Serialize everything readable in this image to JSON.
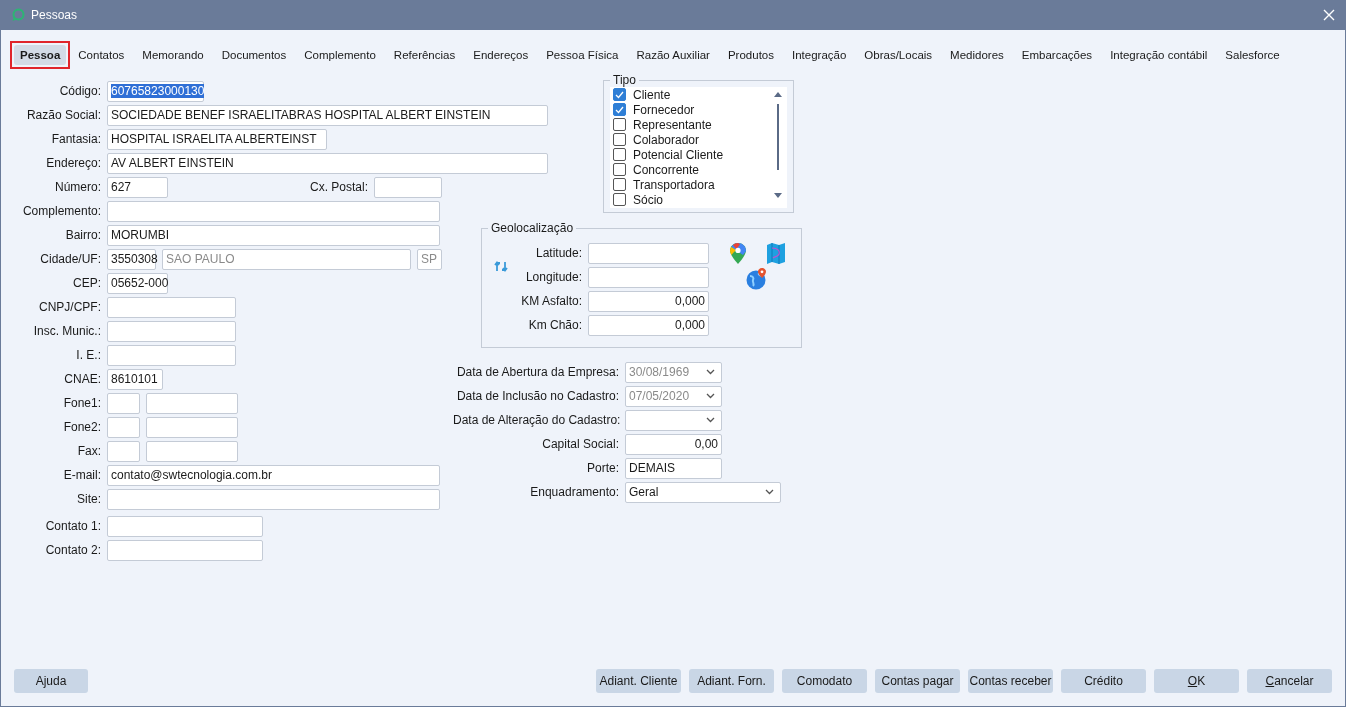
{
  "window": {
    "title": "Pessoas"
  },
  "tabs": [
    {
      "label": "Pessoa",
      "selected": true,
      "annotated": true
    },
    {
      "label": "Contatos",
      "selected": false,
      "annotated": false
    },
    {
      "label": "Memorando",
      "selected": false,
      "annotated": false
    },
    {
      "label": "Documentos",
      "selected": false,
      "annotated": false
    },
    {
      "label": "Complemento",
      "selected": false,
      "annotated": false
    },
    {
      "label": "Referências",
      "selected": false,
      "annotated": false
    },
    {
      "label": "Endereços",
      "selected": false,
      "annotated": false
    },
    {
      "label": "Pessoa Física",
      "selected": false,
      "annotated": false
    },
    {
      "label": "Razão Auxiliar",
      "selected": false,
      "annotated": false
    },
    {
      "label": "Produtos",
      "selected": false,
      "annotated": false
    },
    {
      "label": "Integração",
      "selected": false,
      "annotated": false
    },
    {
      "label": "Obras/Locais",
      "selected": false,
      "annotated": false
    },
    {
      "label": "Medidores",
      "selected": false,
      "annotated": false
    },
    {
      "label": "Embarcações",
      "selected": false,
      "annotated": false
    },
    {
      "label": "Integração contábil",
      "selected": false,
      "annotated": false
    },
    {
      "label": "Salesforce",
      "selected": false,
      "annotated": false
    }
  ],
  "left_form": {
    "rows": [
      {
        "label": "Código:",
        "items": [
          {
            "kind": "field",
            "value": "60765823000130",
            "text_selected": true
          }
        ]
      },
      {
        "label": "Razão Social:",
        "items": [
          {
            "kind": "field",
            "value": "SOCIEDADE BENEF ISRAELITABRAS HOSPITAL ALBERT EINSTEIN"
          }
        ]
      },
      {
        "label": "Fantasia:",
        "items": [
          {
            "kind": "field",
            "value": "HOSPITAL ISRAELITA ALBERTEINST"
          }
        ]
      },
      {
        "label": "Endereço:",
        "items": [
          {
            "kind": "field",
            "value": "AV ALBERT EINSTEIN"
          }
        ]
      },
      {
        "label": "Número:",
        "items": [
          {
            "kind": "field",
            "value": "627"
          },
          {
            "kind": "label",
            "text": "Cx. Postal:"
          },
          {
            "kind": "field"
          }
        ]
      },
      {
        "label": "Complemento:",
        "items": [
          {
            "kind": "field"
          }
        ]
      },
      {
        "label": "Bairro:",
        "items": [
          {
            "kind": "field",
            "value": "MORUMBI"
          }
        ]
      },
      {
        "label": "Cidade/UF:",
        "items": [
          {
            "kind": "field",
            "value": "3550308"
          },
          {
            "kind": "field",
            "value": "SAO PAULO",
            "disabled": true
          },
          {
            "kind": "field",
            "value": "SP",
            "disabled": true
          }
        ]
      },
      {
        "label": "CEP:",
        "items": [
          {
            "kind": "field",
            "value": "05652-000"
          }
        ]
      },
      {
        "label": "CNPJ/CPF:",
        "items": [
          {
            "kind": "field"
          }
        ]
      },
      {
        "label": "Insc. Munic.:",
        "items": [
          {
            "kind": "field"
          }
        ]
      },
      {
        "label": "I. E.:",
        "items": [
          {
            "kind": "field"
          }
        ]
      },
      {
        "label": "CNAE:",
        "items": [
          {
            "kind": "field",
            "value": "8610101"
          }
        ]
      },
      {
        "label": "Fone1:",
        "items": [
          {
            "kind": "field"
          },
          {
            "kind": "field"
          }
        ]
      },
      {
        "label": "Fone2:",
        "items": [
          {
            "kind": "field"
          },
          {
            "kind": "field"
          }
        ]
      },
      {
        "label": "Fax:",
        "items": [
          {
            "kind": "field"
          },
          {
            "kind": "field"
          }
        ]
      },
      {
        "label": "E-mail:",
        "items": [
          {
            "kind": "field",
            "value": "contato@swtecnologia.com.br"
          }
        ]
      },
      {
        "label": "Site:",
        "items": [
          {
            "kind": "field"
          }
        ]
      }
    ],
    "contact_rows": [
      {
        "label": "Contato 1:",
        "items": [
          {
            "kind": "field"
          }
        ]
      },
      {
        "label": "Contato 2:",
        "items": [
          {
            "kind": "field"
          }
        ]
      }
    ]
  },
  "tipo": {
    "title": "Tipo",
    "items": [
      {
        "label": "Cliente",
        "checked": true
      },
      {
        "label": "Fornecedor",
        "checked": true
      },
      {
        "label": "Representante",
        "checked": false
      },
      {
        "label": "Colaborador",
        "checked": false
      },
      {
        "label": "Potencial Cliente",
        "checked": false
      },
      {
        "label": "Concorrente",
        "checked": false
      },
      {
        "label": "Transportadora",
        "checked": false
      },
      {
        "label": "Sócio",
        "checked": false
      }
    ]
  },
  "geolocalizacao": {
    "title": "Geolocalização",
    "rows": [
      {
        "label": "Latitude:"
      },
      {
        "label": "Longitude:"
      },
      {
        "label": "KM Asfalto:",
        "value": "0,000"
      },
      {
        "label": "Km Chão:",
        "value": "0,000"
      }
    ]
  },
  "company_rows": [
    {
      "label": "Data de Abertura da Empresa:",
      "kind": "date",
      "value": "30/08/1969",
      "disabled": true
    },
    {
      "label": "Data de Inclusão no Cadastro:",
      "kind": "date",
      "value": "07/05/2020",
      "disabled": true
    },
    {
      "label": "Data de Alteração do Cadastro:",
      "kind": "date"
    },
    {
      "label": "Capital Social:",
      "kind": "number",
      "value": "0,00"
    },
    {
      "label": "Porte:",
      "kind": "text",
      "value": "DEMAIS"
    },
    {
      "label": "Enquadramento:",
      "kind": "select",
      "value": "Geral"
    }
  ],
  "buttons_left": [
    {
      "label": "Ajuda"
    }
  ],
  "buttons_right": [
    {
      "label": "Adiant. Cliente"
    },
    {
      "label": "Adiant. Forn."
    },
    {
      "label": "Comodato"
    },
    {
      "label": "Contas pagar"
    },
    {
      "label": "Contas receber"
    },
    {
      "label": "Crédito"
    },
    {
      "label": "OK",
      "underline_first": true
    },
    {
      "label": "Cancelar",
      "underline_first": true
    }
  ]
}
